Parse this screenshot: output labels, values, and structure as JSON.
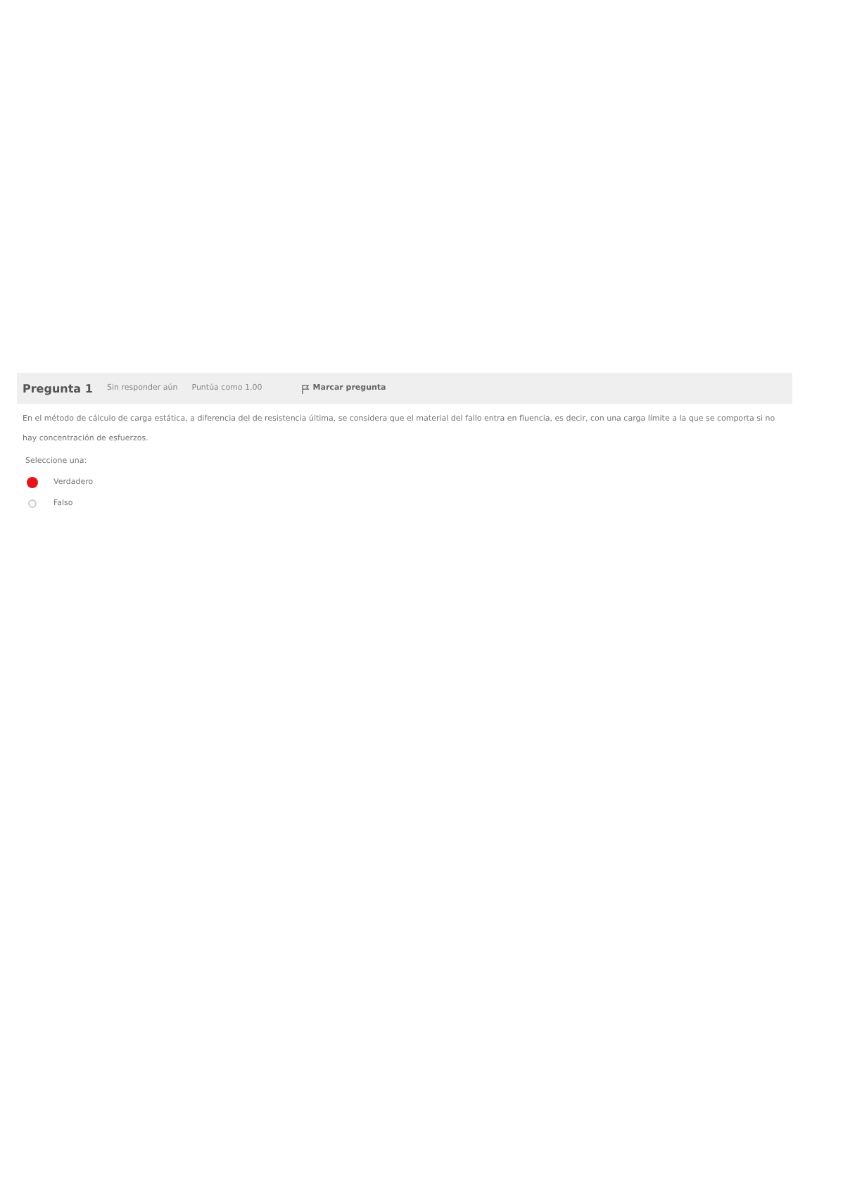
{
  "question": {
    "title": "Pregunta 1",
    "status": "Sin responder aún",
    "points": "Puntúa como 1,00",
    "flag_label": "Marcar pregunta",
    "text": "En el método de cálculo de carga estática, a diferencia del de resistencia última, se considera que el material del fallo entra en fluencia, es decir, con una carga límite a la que se comporta si no hay concentración de esfuerzos.",
    "prompt": "Seleccione una:",
    "options": [
      {
        "label": "Verdadero",
        "selected": true
      },
      {
        "label": "Falso",
        "selected": false
      }
    ]
  }
}
